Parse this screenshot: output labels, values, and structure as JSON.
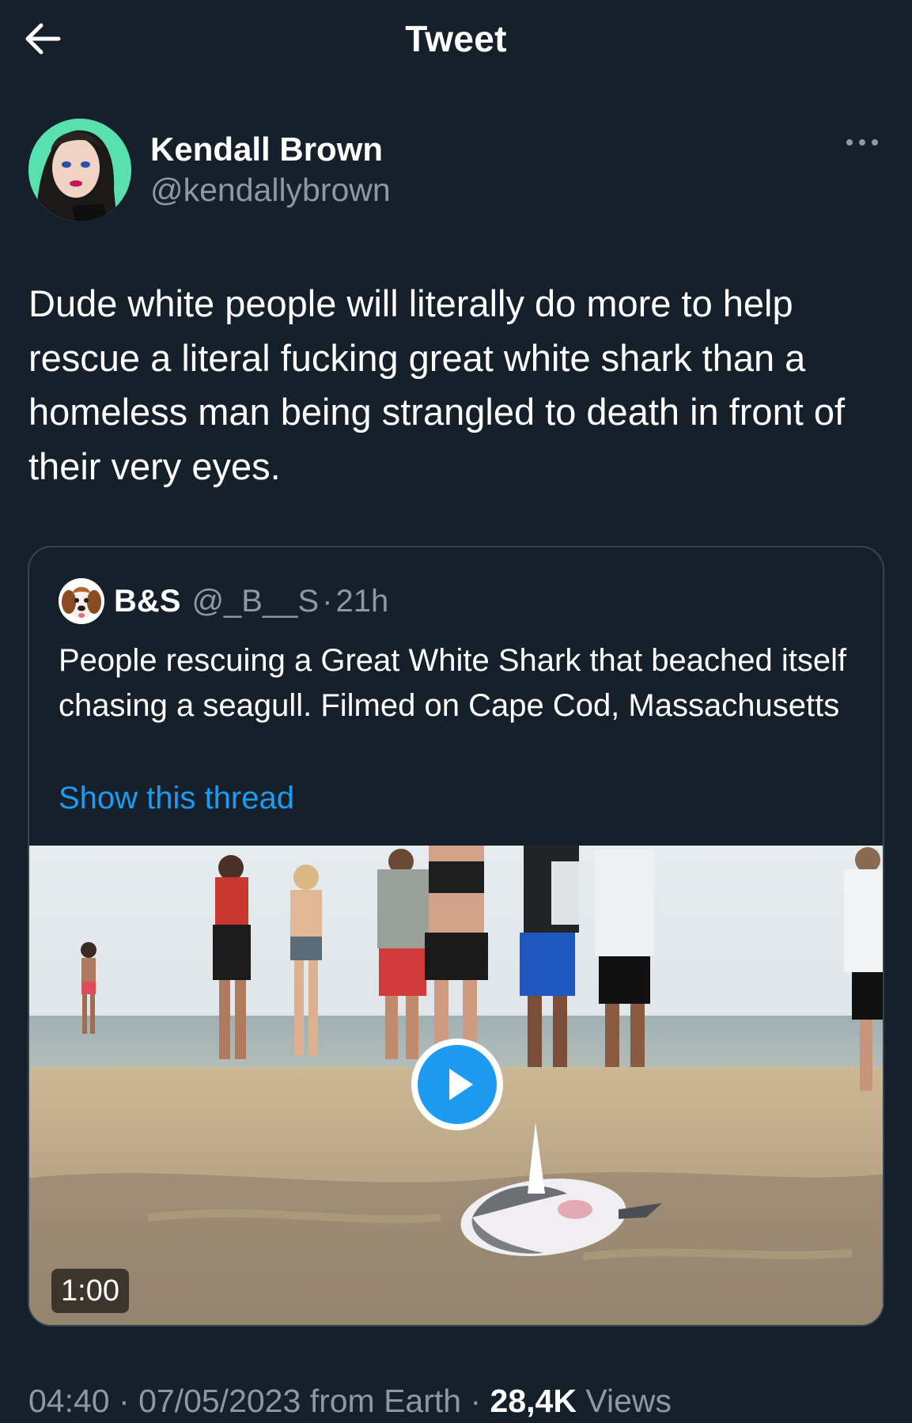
{
  "header": {
    "title": "Tweet",
    "back_icon": "arrow-left-icon"
  },
  "author": {
    "name": "Kendall Brown",
    "handle": "@kendallybrown",
    "more_icon": "more-horizontal-icon"
  },
  "tweet": {
    "text": "Dude white people will literally do more to help rescue a literal fucking great white shark than a homeless man being strangled to death in front of their very eyes."
  },
  "quote": {
    "name": "B&S",
    "handle": "@_B__S",
    "separator": "·",
    "time": "21h",
    "text": "People rescuing a Great White Shark that beached itself chasing a seagull. Filmed on Cape Cod, Massachusetts",
    "show_thread": "Show this thread",
    "media": {
      "duration": "1:00",
      "play_icon": "play-icon"
    }
  },
  "footer": {
    "time": "04:40",
    "date": "07/05/2023",
    "source": "from Earth",
    "views_count": "28,4K",
    "views_label": "Views",
    "separator": "·"
  },
  "colors": {
    "background": "#15202b",
    "secondary_text": "#8b98a5",
    "accent": "#1d9bf0",
    "border": "#38444d"
  }
}
